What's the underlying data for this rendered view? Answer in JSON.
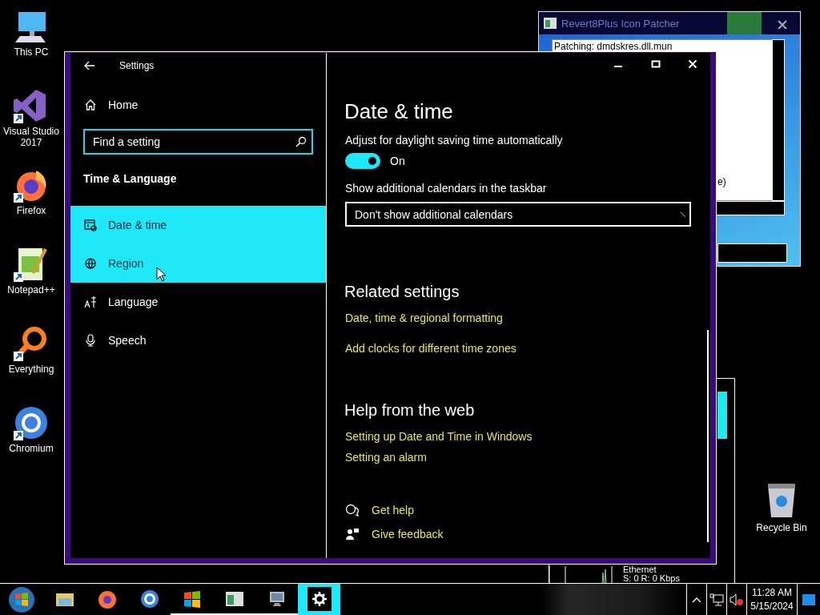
{
  "desktop_icons": [
    {
      "label": "This PC",
      "shortcut": false
    },
    {
      "label": "Visual Studio 2017",
      "shortcut": true
    },
    {
      "label": "Firefox",
      "shortcut": true
    },
    {
      "label": "Notepad++",
      "shortcut": true
    },
    {
      "label": "Everything",
      "shortcut": true
    },
    {
      "label": "Chromium",
      "shortcut": true
    }
  ],
  "recycle_bin": {
    "label": "Recycle Bin"
  },
  "patcher_window": {
    "title": "Revert8Plus Icon Patcher",
    "log_first_line": "Patching: dmdskres.dll.mun",
    "log_fragment": "e)"
  },
  "network_window": {
    "adapter": "Ethernet",
    "rates": "S: 0 R: 0 Kbps"
  },
  "settings": {
    "title": "Settings",
    "home": "Home",
    "search": {
      "placeholder": "Find a setting"
    },
    "section": "Time & Language",
    "nav": [
      {
        "label": "Date & time",
        "selected": true,
        "hovered": false
      },
      {
        "label": "Region",
        "selected": false,
        "hovered": true
      },
      {
        "label": "Language",
        "selected": false,
        "hovered": false
      },
      {
        "label": "Speech",
        "selected": false,
        "hovered": false
      }
    ],
    "page_title": "Date & time",
    "daylight": {
      "label": "Adjust for daylight saving time automatically",
      "on": true,
      "state_text": "On"
    },
    "calendars": {
      "label": "Show additional calendars in the taskbar",
      "value": "Don't show additional calendars"
    },
    "related": {
      "title": "Related settings",
      "links": [
        "Date, time & regional formatting",
        "Add clocks for different time zones"
      ]
    },
    "help": {
      "title": "Help from the web",
      "links": [
        "Setting up Date and Time in Windows",
        "Setting an alarm"
      ]
    },
    "footer_links": [
      "Get help",
      "Give feedback"
    ]
  },
  "taskbar": {
    "items": [
      {
        "running": false,
        "active": false
      },
      {
        "running": false,
        "active": false
      },
      {
        "running": false,
        "active": false
      },
      {
        "running": true,
        "active": false
      },
      {
        "running": true,
        "active": false
      },
      {
        "running": true,
        "active": false
      },
      {
        "running": true,
        "active": true
      }
    ],
    "tray": {
      "volume_muted": true,
      "time": "11:28 AM",
      "date": "5/15/2024"
    }
  }
}
